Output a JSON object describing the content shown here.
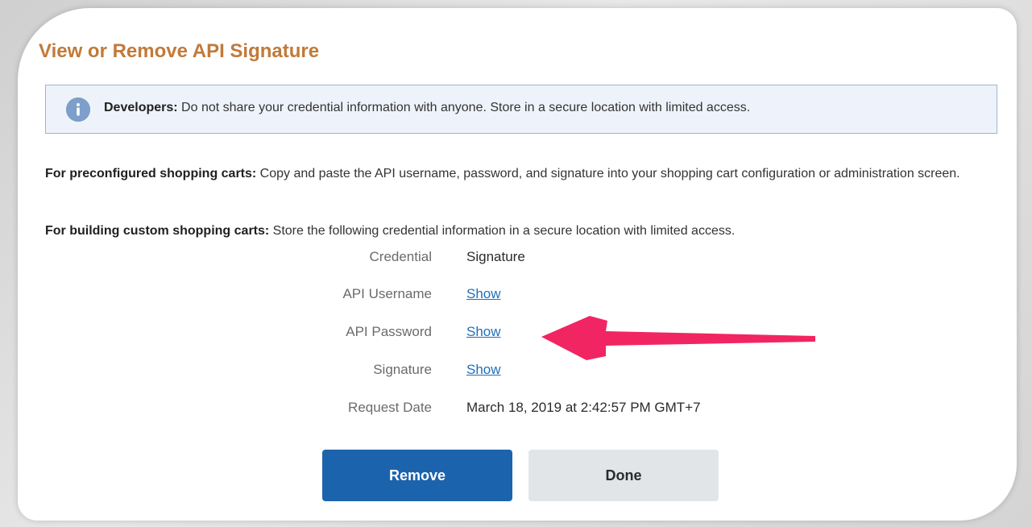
{
  "page": {
    "title": "View or Remove API Signature"
  },
  "notice": {
    "label": "Developers:",
    "text": " Do not share your credential information with anyone. Store in a secure location with limited access."
  },
  "paragraphs": {
    "preconfigured_label": "For preconfigured shopping carts:",
    "preconfigured_text": " Copy and paste the API username, password, and signature into your shopping cart configuration or administration screen.",
    "custom_label": "For building custom shopping carts:",
    "custom_text": " Store the following credential information in a secure location with limited access."
  },
  "credentials": {
    "credential_label": "Credential",
    "credential_value": "Signature",
    "username_label": "API Username",
    "username_link": "Show",
    "password_label": "API Password",
    "password_link": "Show",
    "signature_label": "Signature",
    "signature_link": "Show",
    "request_date_label": "Request Date",
    "request_date_value": "March 18, 2019 at 2:42:57 PM GMT+7"
  },
  "actions": {
    "remove_label": "Remove",
    "done_label": "Done"
  },
  "colors": {
    "title": "#c17a3a",
    "link": "#1f6fb8",
    "primary_button": "#1c63ad",
    "secondary_button": "#e2e5e8",
    "annotation_arrow": "#f0195a"
  },
  "icons": {
    "notice_icon": "info-icon",
    "annotation": "arrow-left-icon"
  }
}
